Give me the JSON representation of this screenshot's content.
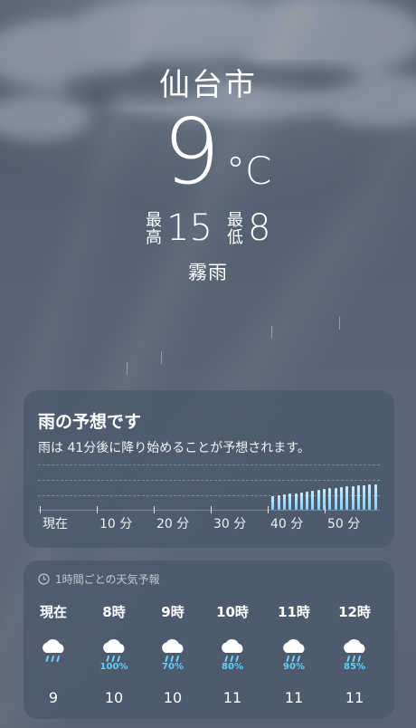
{
  "location": {
    "city": "仙台市"
  },
  "current": {
    "temperature": "9",
    "unit": "°C",
    "high_label": "最高",
    "high": "15",
    "low_label": "最低",
    "low": "8",
    "condition": "霧雨"
  },
  "precipitation": {
    "title": "雨の予想です",
    "description": "雨は 41分後に降り始めることが予想されます。",
    "axis_labels": [
      "現在",
      "10 分",
      "20 分",
      "30 分",
      "40 分",
      "50 分"
    ],
    "intensity_by_minute": [
      0,
      0,
      0,
      0,
      0,
      0,
      0,
      0,
      0,
      0,
      0,
      0,
      0,
      0,
      0,
      0,
      0,
      0,
      0,
      0,
      0,
      0,
      0,
      0,
      0,
      0,
      0,
      0,
      0,
      0,
      0,
      0,
      0,
      0,
      0,
      0,
      0,
      0,
      0,
      0,
      0,
      0.35,
      0.38,
      0.4,
      0.42,
      0.44,
      0.46,
      0.48,
      0.5,
      0.52,
      0.54,
      0.56,
      0.58,
      0.6,
      0.62,
      0.63,
      0.64,
      0.65,
      0.66,
      0.67
    ],
    "colors": {
      "bar": "#7fd0ff"
    }
  },
  "hourly": {
    "header": "1時間ごとの天気予報",
    "header_icon": "clock-icon",
    "items": [
      {
        "time": "現在",
        "icon": "rain-cloud-icon",
        "pop": "",
        "temp": "9"
      },
      {
        "time": "8時",
        "icon": "rain-cloud-icon",
        "pop": "100%",
        "temp": "10"
      },
      {
        "time": "9時",
        "icon": "rain-cloud-icon",
        "pop": "70%",
        "temp": "10"
      },
      {
        "time": "10時",
        "icon": "rain-cloud-icon",
        "pop": "80%",
        "temp": "11"
      },
      {
        "time": "11時",
        "icon": "rain-cloud-icon",
        "pop": "90%",
        "temp": "11"
      },
      {
        "time": "12時",
        "icon": "rain-cloud-icon",
        "pop": "85%",
        "temp": "11"
      }
    ],
    "colors": {
      "pop": "#5fd0ff"
    }
  }
}
